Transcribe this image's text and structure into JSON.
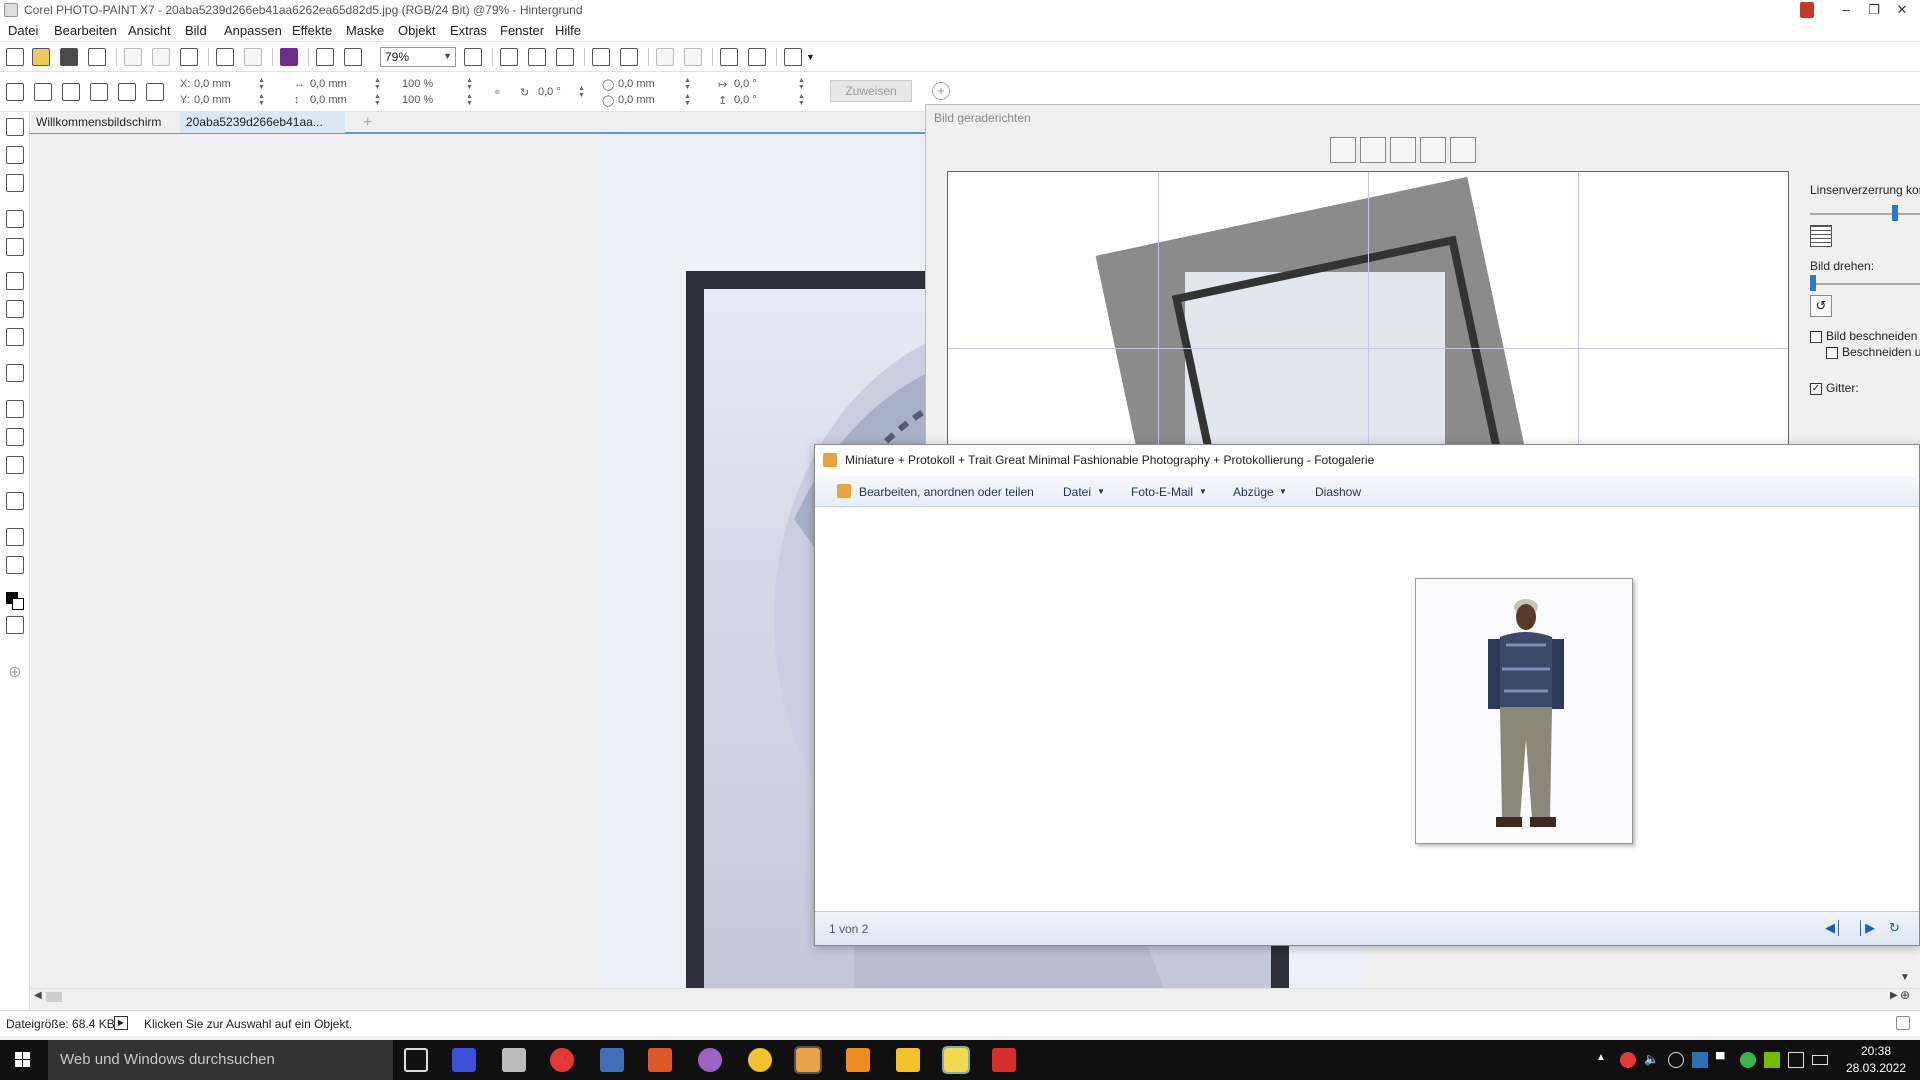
{
  "window": {
    "title": "Corel PHOTO-PAINT X7 - 20aba5239d266eb41aa6262ea65d82d5.jpg (RGB/24 Bit) @79% - Hintergrund"
  },
  "menu": [
    "Datei",
    "Bearbeiten",
    "Ansicht",
    "Bild",
    "Anpassen",
    "Effekte",
    "Maske",
    "Objekt",
    "Extras",
    "Fenster",
    "Hilfe"
  ],
  "toolbar": {
    "zoom_value": "79%"
  },
  "property_bar": {
    "x_label": "X:",
    "x_value": "0,0 mm",
    "y_label": "Y:",
    "y_value": "0,0 mm",
    "w_value": "0,0 mm",
    "h_value": "0,0 mm",
    "scale_x": "100 %",
    "scale_y": "100 %",
    "rotation": "0,0 °",
    "center_x": "0,0 mm",
    "center_y": "0,0 mm",
    "skew_h": "0,0 °",
    "skew_v": "0,0 °",
    "assign_label": "Zuweisen"
  },
  "doc_tabs": [
    "Willkommensbildschirm",
    "20aba5239d266eb41aa..."
  ],
  "status_bar": {
    "file_size": "Dateigröße: 68.4 KB",
    "hint": "Klicken Sie zur Auswahl auf ein Objekt."
  },
  "straighten_dialog": {
    "title": "Bild geraderichten",
    "lens_label": "Linsenverzerrung kor",
    "lens_slider_value": 0.95,
    "rotate_label": "Bild drehen:",
    "rotate_slider_value": 0.05,
    "crop_label": "Bild beschneiden",
    "crop_checked": false,
    "crop_resample_label": "Beschneiden u",
    "crop_resample_checked": false,
    "grid_label": "Gitter:",
    "grid_checked": true,
    "grid_color": "#d8d8ff"
  },
  "gallery": {
    "title": "Miniature + Protokoll + Trait Great Minimal Fashionable Photography + Protokollierung - Fotogalerie",
    "commands": {
      "edit": "Bearbeiten, anordnen oder teilen",
      "file": "Datei",
      "email": "Foto-E-Mail",
      "prints": "Abzüge",
      "slideshow": "Diashow"
    },
    "counter": "1 von 2"
  },
  "taskbar": {
    "search_placeholder": "Web und Windows durchsuchen",
    "time": "20:38",
    "date": "28.03.2022"
  },
  "colors": {
    "accent": "#2a78d4",
    "tab_active": "#dbe7f5",
    "frame": "#2e2f38"
  }
}
